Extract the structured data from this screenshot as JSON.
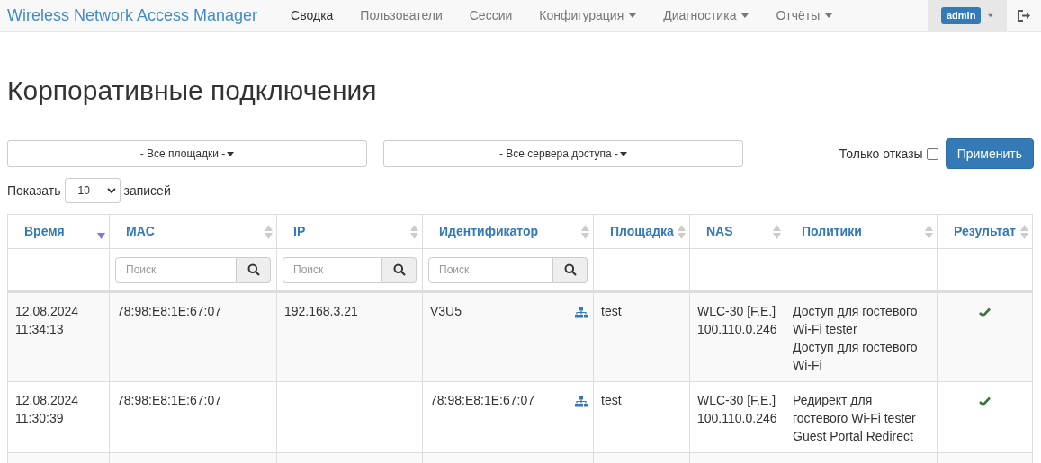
{
  "navbar": {
    "brand": "Wireless Network Access Manager",
    "items": [
      {
        "label": "Сводка",
        "selected": true,
        "dropdown": false
      },
      {
        "label": "Пользователи",
        "selected": false,
        "dropdown": false
      },
      {
        "label": "Сессии",
        "selected": false,
        "dropdown": false
      },
      {
        "label": "Конфигурация",
        "selected": false,
        "dropdown": true
      },
      {
        "label": "Диагностика",
        "selected": false,
        "dropdown": true
      },
      {
        "label": "Отчёты",
        "selected": false,
        "dropdown": true
      }
    ],
    "user": "admin"
  },
  "page_title": "Корпоративные подключения",
  "filters": {
    "site": "- Все площадки -",
    "server": "- Все сервера доступа -",
    "only_failures": {
      "label": "Только отказы",
      "checked": false
    },
    "apply": "Применить"
  },
  "page_size": {
    "prefix": "Показать",
    "value": "10",
    "suffix": "записей"
  },
  "table": {
    "columns": [
      {
        "label": "Время",
        "sorted": true
      },
      {
        "label": "MAC",
        "sorted": false,
        "placeholder": "Поиск"
      },
      {
        "label": "IP",
        "sorted": false,
        "placeholder": "Поиск"
      },
      {
        "label": "Идентификатор",
        "sorted": false,
        "placeholder": "Поиск"
      },
      {
        "label": "Площадка",
        "sorted": false
      },
      {
        "label": "NAS",
        "sorted": false
      },
      {
        "label": "Политики",
        "sorted": false
      },
      {
        "label": "Результат",
        "sorted": false
      }
    ],
    "rows": [
      {
        "time": [
          "12.08.2024",
          "11:34:13"
        ],
        "mac": "78:98:E8:1E:67:07",
        "ip": "192.168.3.21",
        "identifier": "V3U5",
        "tree": true,
        "site": "test",
        "nas": [
          "WLC-30 [F.E.]",
          "100.110.0.246"
        ],
        "policies": [
          "Доступ для гостевого Wi-Fi tester",
          "Доступ для гостевого Wi-Fi"
        ],
        "success": true
      },
      {
        "time": [
          "12.08.2024",
          "11:30:39"
        ],
        "mac": "78:98:E8:1E:67:07",
        "identifier": "78:98:E8:1E:67:07",
        "tree": true,
        "site": "test",
        "nas": [
          "WLC-30 [F.E.]",
          "100.110.0.246"
        ],
        "policies": [
          "Редирект для гостевого Wi-Fi tester",
          "Guest Portal Redirect"
        ],
        "success": true
      }
    ]
  }
}
